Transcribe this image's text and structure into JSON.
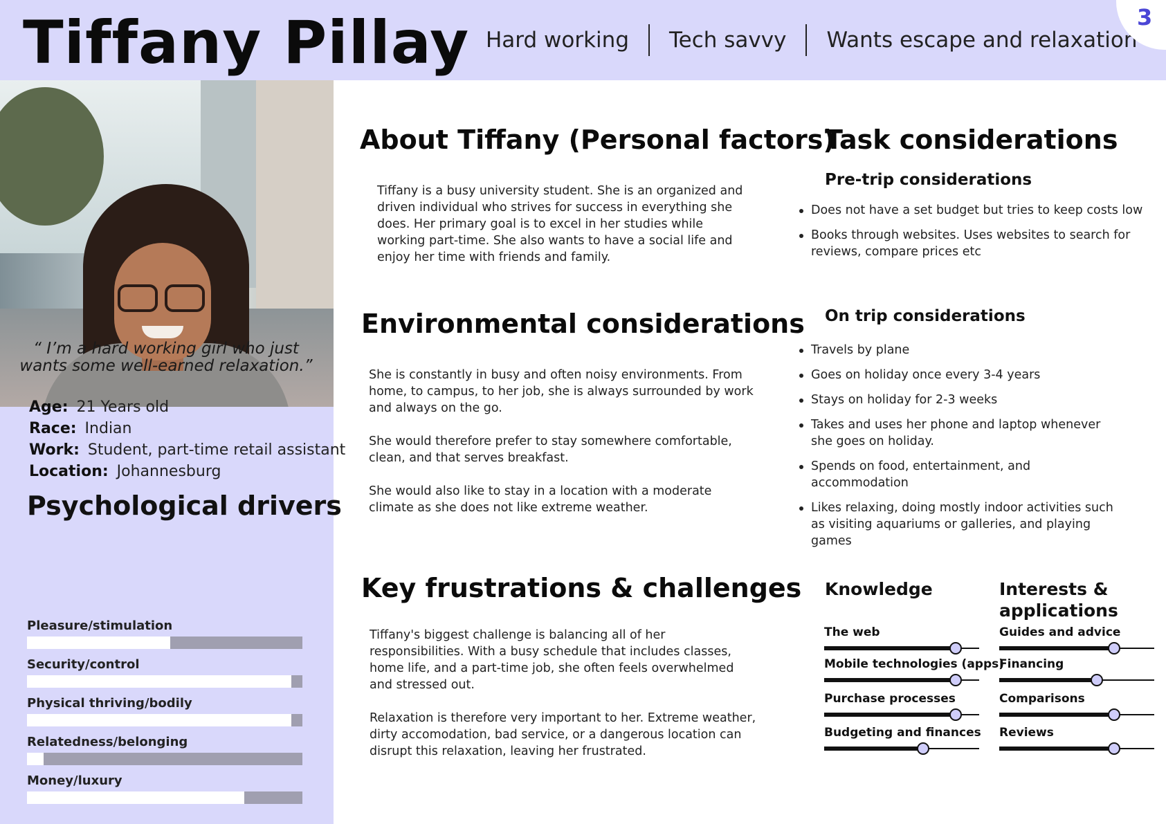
{
  "header": {
    "name": "Tiffany Pillay",
    "traits": [
      "Hard working",
      "Tech savvy",
      "Wants escape and relaxation"
    ],
    "page_number": "3"
  },
  "profile": {
    "quote_open": "“",
    "quote": "I’m a hard working girl who just wants some well-earned relaxation.”",
    "facts": [
      {
        "label": "Age:",
        "value": "21 Years old"
      },
      {
        "label": "Race:",
        "value": "Indian"
      },
      {
        "label": "Work:",
        "value": "Student, part-time retail assistant"
      },
      {
        "label": "Location:",
        "value": "Johannesburg"
      }
    ]
  },
  "psych": {
    "title": "Psychological drivers",
    "drivers": [
      {
        "label": "Pleasure/stimulation",
        "level": 0.52
      },
      {
        "label": "Security/control",
        "level": 0.96
      },
      {
        "label": "Physical thriving/bodily",
        "level": 0.96
      },
      {
        "label": "Relatedness/belonging",
        "level": 0.06
      },
      {
        "label": "Money/luxury",
        "level": 0.79
      }
    ]
  },
  "about": {
    "title": "About Tiffany (Personal factors)",
    "text": "Tiffany is a busy university student. She is an organized and driven individual who strives for success in everything she does. Her primary goal is to excel in her studies while working part-time. She also wants to have a social life and enjoy her time with friends and family."
  },
  "environment": {
    "title": "Environmental considerations",
    "paragraphs": [
      "She is constantly in busy and often noisy environments. From home, to campus, to her job, she is always surrounded by work and always on the go.",
      "She would therefore prefer to stay somewhere comfortable, clean, and that serves breakfast.",
      "She would also like to stay in a location with a moderate climate as she does not like extreme weather."
    ]
  },
  "frustrations": {
    "title": "Key frustrations & challenges",
    "paragraphs": [
      "Tiffany's biggest challenge is balancing all of her responsibilities. With a busy schedule that includes classes, home life, and a part-time job, she often feels overwhelmed and stressed out.",
      "Relaxation is therefore very important to her. Extreme weather, dirty accomodation, bad service, or a dangerous location can disrupt this relaxation, leaving her frustrated."
    ]
  },
  "tasks": {
    "title": "Task considerations",
    "pre_trip": {
      "title": "Pre-trip considerations",
      "items": [
        "Does not have a set budget but tries to keep costs low",
        "Books through websites. Uses websites to search for reviews, compare prices etc"
      ]
    },
    "on_trip": {
      "title": "On trip considerations",
      "items": [
        "Travels by plane",
        "Goes on holiday once every 3-4 years",
        "Stays on holiday for 2-3 weeks",
        "Takes and uses her phone and laptop whenever she goes on holiday.",
        "Spends on food, entertainment, and accommodation",
        "Likes relaxing, doing mostly indoor activities such as visiting aquariums or galleries, and playing games"
      ]
    }
  },
  "knowledge": {
    "title": "Knowledge",
    "items": [
      {
        "label": "The web",
        "level": 0.85
      },
      {
        "label": "Mobile technologies (apps)",
        "level": 0.85
      },
      {
        "label": "Purchase processes",
        "level": 0.85
      },
      {
        "label": "Budgeting and finances",
        "level": 0.64
      }
    ]
  },
  "interests": {
    "title": "Interests & applications",
    "items": [
      {
        "label": "Guides and advice",
        "level": 0.74
      },
      {
        "label": "Financing",
        "level": 0.63
      },
      {
        "label": "Comparisons",
        "level": 0.74
      },
      {
        "label": "Reviews",
        "level": 0.74
      }
    ]
  }
}
